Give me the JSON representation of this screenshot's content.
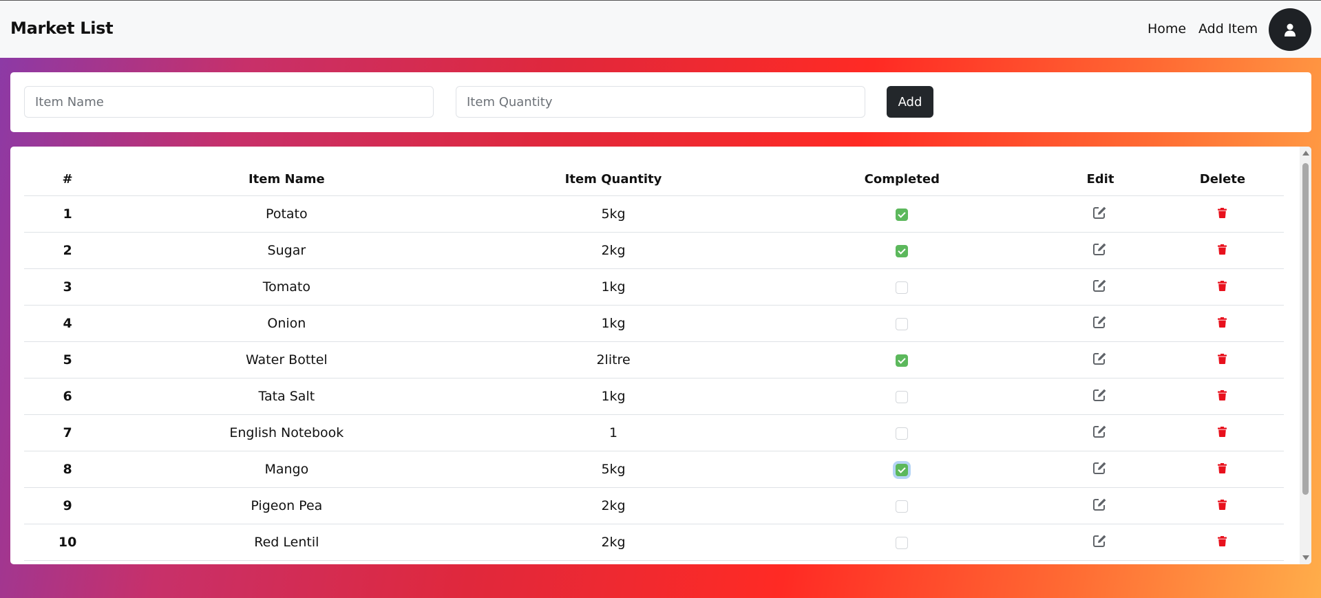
{
  "header": {
    "brand": "Market List",
    "nav": {
      "home": "Home",
      "add_item": "Add Item"
    },
    "avatar_icon": "user-icon"
  },
  "form": {
    "name_placeholder": "Item Name",
    "qty_placeholder": "Item Quantity",
    "add_label": "Add"
  },
  "table": {
    "headers": [
      "#",
      "Item Name",
      "Item Quantity",
      "Completed",
      "Edit",
      "Delete"
    ],
    "rows": [
      {
        "id": "1",
        "name": "Potato",
        "qty": "5kg",
        "completed": true
      },
      {
        "id": "2",
        "name": "Sugar",
        "qty": "2kg",
        "completed": true
      },
      {
        "id": "3",
        "name": "Tomato",
        "qty": "1kg",
        "completed": false
      },
      {
        "id": "4",
        "name": "Onion",
        "qty": "1kg",
        "completed": false
      },
      {
        "id": "5",
        "name": "Water Bottel",
        "qty": "2litre",
        "completed": true
      },
      {
        "id": "6",
        "name": "Tata Salt",
        "qty": "1kg",
        "completed": false
      },
      {
        "id": "7",
        "name": "English Notebook",
        "qty": "1",
        "completed": false
      },
      {
        "id": "8",
        "name": "Mango",
        "qty": "5kg",
        "completed": true,
        "focused": true
      },
      {
        "id": "9",
        "name": "Pigeon Pea",
        "qty": "2kg",
        "completed": false
      },
      {
        "id": "10",
        "name": "Red Lentil",
        "qty": "2kg",
        "completed": false
      }
    ]
  },
  "icons": {
    "edit": "edit-icon",
    "delete": "trash-icon"
  },
  "colors": {
    "check": "#5cb85c",
    "delete": "#e8111d",
    "edit": "#5f6368",
    "button": "#23272b"
  }
}
